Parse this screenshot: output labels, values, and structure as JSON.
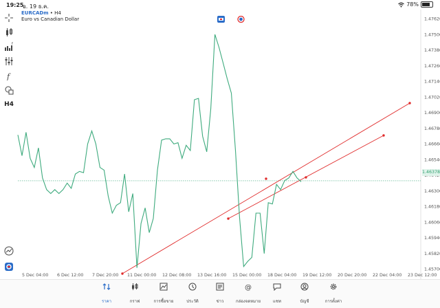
{
  "status_bar": {
    "time": "19:25",
    "date": "อ. 19 ธ.ค.",
    "battery": "78%",
    "battery_level": 0.78
  },
  "chart": {
    "symbol": "EURCADm",
    "timeframe_suffix": " • H4",
    "description": "Euro vs Canadian Dollar",
    "current_price": "1.46378",
    "colors": {
      "price_line": "#3daa7d",
      "trendlines": "#e02b2b",
      "accent": "#2a6cc8"
    }
  },
  "left_toolbar": {
    "icons": [
      "crosshair-icon",
      "candlestick-icon",
      "indicators-icon",
      "settings-sliders-icon",
      "function-icon",
      "shapes-icon"
    ],
    "timeframe_label": "H4"
  },
  "chart_data": {
    "type": "line",
    "price_ticks": [
      "1.47620",
      "1.47500",
      "1.47380",
      "1.47260",
      "1.47140",
      "1.47020",
      "1.46900",
      "1.46780",
      "1.46660",
      "1.46540",
      "1.46420",
      "1.46300",
      "1.46180",
      "1.46060",
      "1.45940",
      "1.45820",
      "1.45700"
    ],
    "time_ticks": [
      "5 Dec 04:00",
      "6 Dec 12:00",
      "7 Dec 20:00",
      "11 Dec 00:00",
      "12 Dec 08:00",
      "13 Dec 16:00",
      "15 Dec 00:00",
      "18 Dec 04:00",
      "19 Dec 12:00",
      "20 Dec 20:00",
      "22 Dec 04:00",
      "23 Dec 12:00"
    ],
    "ylim": [
      1.4565,
      1.4768
    ],
    "series": [
      {
        "values": [
          1.4673,
          1.4657,
          1.4675,
          1.4655,
          1.4648,
          1.4663,
          1.464,
          1.4631,
          1.4628,
          1.4631,
          1.4628,
          1.4631,
          1.4636,
          1.4632,
          1.4643,
          1.4645,
          1.4644,
          1.4666,
          1.4676,
          1.4666,
          1.4648,
          1.4646,
          1.4626,
          1.4613,
          1.4619,
          1.4621,
          1.4643,
          1.4614,
          1.4628,
          1.4571,
          1.4605,
          1.4617,
          1.4598,
          1.4609,
          1.4646,
          1.4669,
          1.467,
          1.467,
          1.4666,
          1.4667,
          1.4655,
          1.4665,
          1.4661,
          1.47,
          1.4701,
          1.4672,
          1.466,
          1.4693,
          1.475,
          1.474,
          1.4728,
          1.4716,
          1.4705,
          1.4661,
          1.461,
          1.4572,
          1.4576,
          1.4579,
          1.4613,
          1.4613,
          1.4582,
          1.4621,
          1.462,
          1.4635,
          1.4631,
          1.4638,
          1.464,
          1.4645,
          1.464,
          1.4637
        ],
        "color": "#3daa7d"
      }
    ]
  },
  "bottom_nav": [
    {
      "icon": "quotes-icon",
      "label": "ราคา",
      "active": true
    },
    {
      "icon": "chart-icon",
      "label": "กราฟ",
      "active": false
    },
    {
      "icon": "trade-icon",
      "label": "การซื้อขาย",
      "active": false
    },
    {
      "icon": "history-icon",
      "label": "ประวัติ",
      "active": false
    },
    {
      "icon": "news-icon",
      "label": "ข่าว",
      "active": false
    },
    {
      "icon": "mailbox-icon",
      "label": "กล่องจดหมาย",
      "active": false
    },
    {
      "icon": "chat-icon",
      "label": "แชท",
      "active": false
    },
    {
      "icon": "account-icon",
      "label": "บัญชี",
      "active": false
    },
    {
      "icon": "gear-icon",
      "label": "การตั้งค่า",
      "active": false
    }
  ]
}
